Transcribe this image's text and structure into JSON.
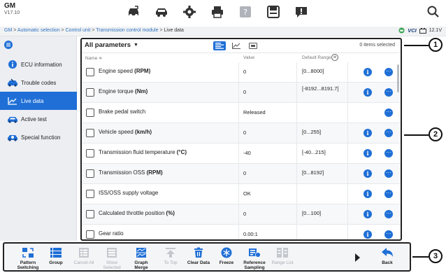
{
  "header": {
    "make": "GM",
    "version": "V17.10"
  },
  "breadcrumb": {
    "items": [
      "GM",
      "Automatic selection",
      "Control unit",
      "Transmission control module",
      "Live data"
    ],
    "separator": ">"
  },
  "status": {
    "vci_label": "VCI",
    "battery": "12.1V"
  },
  "sidebar": {
    "items": [
      {
        "label": "ECU information",
        "icon": "info-icon"
      },
      {
        "label": "Trouble codes",
        "icon": "car-wrench-icon"
      },
      {
        "label": "Live data",
        "icon": "line-chart-icon"
      },
      {
        "label": "Active test",
        "icon": "car-icon"
      },
      {
        "label": "Special function",
        "icon": "car-gear-icon"
      }
    ],
    "active_index": 2
  },
  "panel": {
    "filter_label": "All parameters",
    "selected_text": "0 items selected",
    "columns": {
      "name": "Name ≑",
      "value": "Value",
      "range": "Default Range"
    },
    "rows": [
      {
        "name": "Engine speed ",
        "unit": "(RPM)",
        "value": "0",
        "range": "[0...8000]",
        "info": true
      },
      {
        "name": "Engine torque ",
        "unit": "(Nm)",
        "value": "0",
        "range": "[-8192...8191.7]",
        "info": true
      },
      {
        "name": "Brake pedal switch",
        "unit": "",
        "value": "Released",
        "range": "",
        "info": false
      },
      {
        "name": "Vehicle speed ",
        "unit": "(km/h)",
        "value": "0",
        "range": "[0...255]",
        "info": true
      },
      {
        "name": "Transmission fluid temperature ",
        "unit": "(°C)",
        "value": "-40",
        "range": "[-40...215]",
        "info": true
      },
      {
        "name": "Transmission OSS ",
        "unit": "(RPM)",
        "value": "0",
        "range": "[0...8192]",
        "info": true
      },
      {
        "name": "ISS/OSS supply voltage",
        "unit": "",
        "value": "OK",
        "range": "",
        "info": true
      },
      {
        "name": "Calculated throttle position ",
        "unit": "(%)",
        "value": "0",
        "range": "[0...100]",
        "info": true
      },
      {
        "name": "Gear ratio",
        "unit": "",
        "value": "0.00:1",
        "range": "",
        "info": true
      }
    ]
  },
  "toolbar": {
    "items": [
      {
        "label": "Pattern Switching",
        "icon": "pattern-switch-icon",
        "enabled": true
      },
      {
        "label": "Group",
        "icon": "group-icon",
        "enabled": true
      },
      {
        "label": "Cancel All",
        "icon": "cancel-all-icon",
        "enabled": false
      },
      {
        "label": "Show Selected",
        "icon": "show-selected-icon",
        "enabled": false
      },
      {
        "label": "Graph Merge",
        "icon": "graph-merge-icon",
        "enabled": true
      },
      {
        "label": "To Top",
        "icon": "to-top-icon",
        "enabled": false
      },
      {
        "label": "Clear Data",
        "icon": "trash-icon",
        "enabled": true
      },
      {
        "label": "Freeze",
        "icon": "snowflake-icon",
        "enabled": true
      },
      {
        "label": "Reference Sampling",
        "icon": "reference-sampling-icon",
        "enabled": true
      },
      {
        "label": "Range List",
        "icon": "range-list-icon",
        "enabled": false
      },
      {
        "label": "Back",
        "icon": "back-arrow-icon",
        "enabled": true
      }
    ]
  },
  "callouts": [
    "1",
    "2",
    "3"
  ],
  "colors": {
    "accent": "#1f6fd6",
    "sidebar_bg": "#eceef2",
    "disabled": "#a8acb3"
  }
}
